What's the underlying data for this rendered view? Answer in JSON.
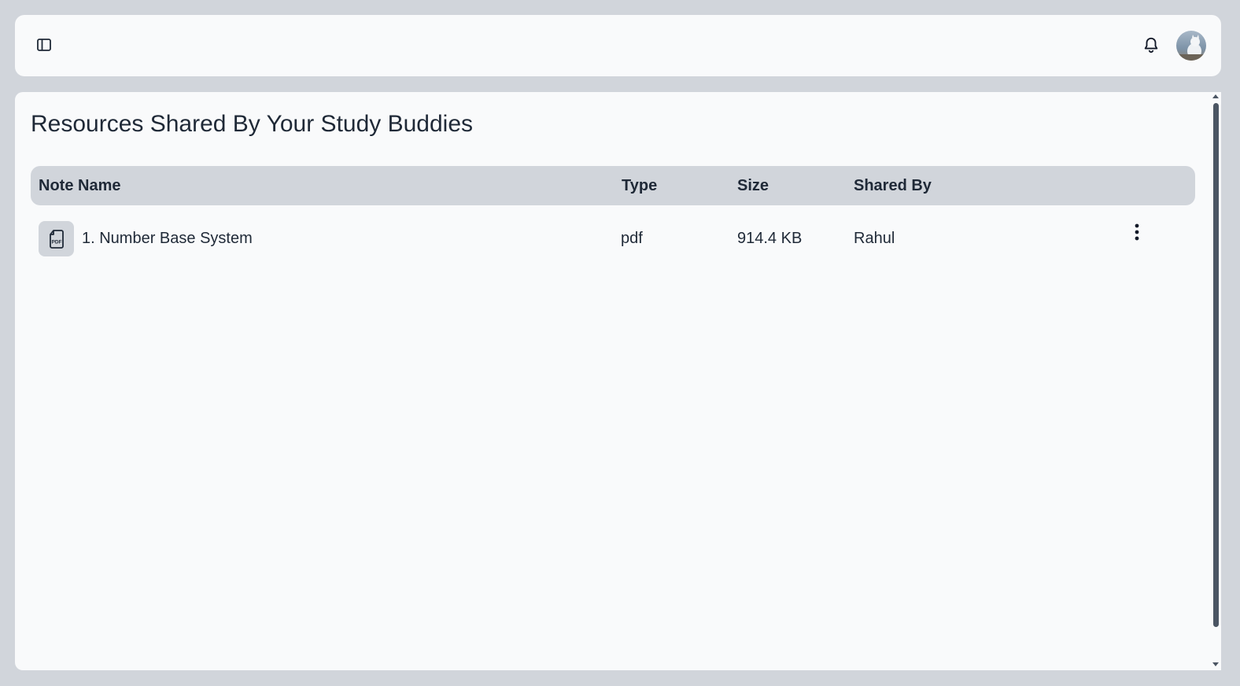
{
  "header": {
    "sidebar_toggle_icon": "sidebar-toggle-icon",
    "notification_icon": "bell-icon",
    "avatar_alt": "user avatar"
  },
  "main": {
    "title": "Resources Shared By Your Study Buddies",
    "table": {
      "columns": [
        "Note Name",
        "Type",
        "Size",
        "Shared By"
      ],
      "rows": [
        {
          "icon": "pdf-file-icon",
          "icon_label": "PDF",
          "name": "1. Number Base System",
          "type": "pdf",
          "size": "914.4 KB",
          "shared_by": "Rahul",
          "menu_icon": "more-vertical-icon"
        }
      ]
    }
  },
  "colors": {
    "background": "#d1d5db",
    "surface": "#f9fafb",
    "text": "#1f2937",
    "header_row": "#d1d5db",
    "scroll_thumb": "#4b5563"
  }
}
